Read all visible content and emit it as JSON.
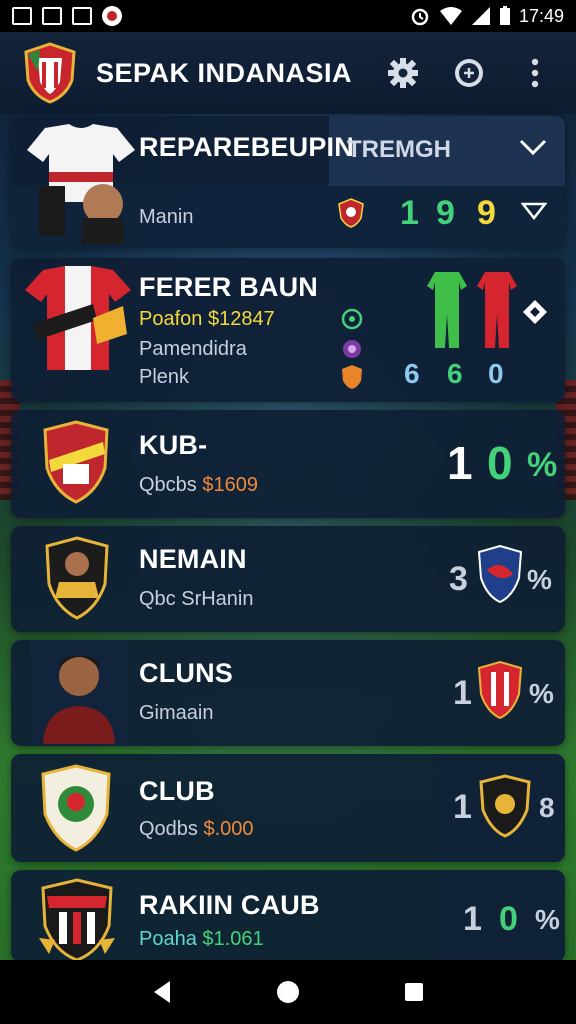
{
  "status_bar": {
    "time": "17:49"
  },
  "app": {
    "title": "SEPAK INDANASIA"
  },
  "cards": [
    {
      "name": "REPAREBEUPIN",
      "tab": "TREMGH",
      "sub": "Manin",
      "stats": [
        "1",
        "9",
        "9"
      ]
    },
    {
      "name": "FERER BAUN",
      "price_line": "Poafon $12847",
      "sub1": "Pamendidra",
      "sub2": "Plenk",
      "stats": [
        "6",
        "6",
        "0"
      ]
    },
    {
      "name": "KUB-",
      "sub_prefix": "Qbcbs",
      "price": "$1609",
      "stats": [
        "1",
        "0",
        "%"
      ]
    },
    {
      "name": "NEMAIN",
      "sub": "Qbc SrHanin",
      "stats": [
        "3",
        "%"
      ]
    },
    {
      "name": "CLUNS",
      "sub": "Gimaain",
      "stats": [
        "1",
        "%"
      ]
    },
    {
      "name": "CLUB",
      "sub_prefix": "Qodbs",
      "price": "$.000",
      "stats": [
        "1",
        "8"
      ]
    },
    {
      "name": "RAKIIN CAUB",
      "sub_prefix": "Poaha",
      "price": "$1.061",
      "stats": [
        "1",
        "0",
        "%"
      ]
    }
  ],
  "colors": {
    "accent_green": "#43d27a",
    "accent_yellow": "#f4d93c",
    "accent_orange": "#f08a3a",
    "card_bg": "#0e1e34"
  }
}
